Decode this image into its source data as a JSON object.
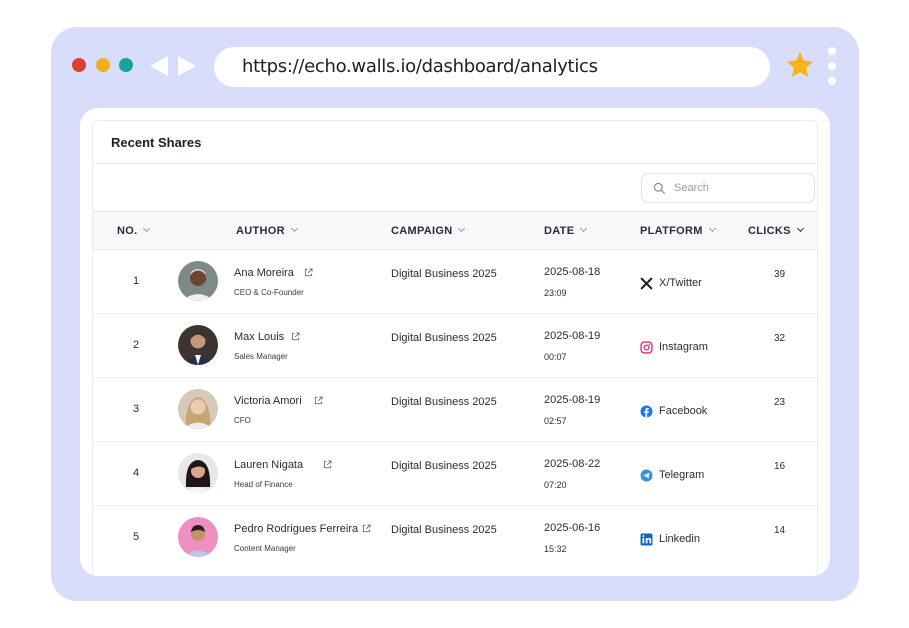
{
  "browser": {
    "url": "https://echo.walls.io/dashboard/analytics",
    "colors": {
      "frame": "#d9ddfc",
      "red": "#d9412e",
      "yellow": "#f2b01e",
      "teal": "#15a39b",
      "star": "#f7b418"
    }
  },
  "panel": {
    "title": "Recent Shares",
    "search_placeholder": "Search"
  },
  "table": {
    "columns": [
      "NO.",
      "AUTHOR",
      "CAMPAIGN",
      "DATE",
      "PLATFORM",
      "CLICKS"
    ],
    "rows": [
      {
        "no": "1",
        "name": "Ana Moreira",
        "role": "CEO & Co-Founder",
        "campaign": "Digital Business 2025",
        "date": "2025-08-18",
        "time": "23:09",
        "platform": "X/Twitter",
        "platform_icon": "x-twitter-icon",
        "clicks": "39"
      },
      {
        "no": "2",
        "name": "Max Louis",
        "role": "Sales Manager",
        "campaign": "Digital Business 2025",
        "date": "2025-08-19",
        "time": "00:07",
        "platform": "Instagram",
        "platform_icon": "instagram-icon",
        "clicks": "32"
      },
      {
        "no": "3",
        "name": "Victoria Amori",
        "role": "CFO",
        "campaign": "Digital Business 2025",
        "date": "2025-08-19",
        "time": "02:57",
        "platform": "Facebook",
        "platform_icon": "facebook-icon",
        "clicks": "23"
      },
      {
        "no": "4",
        "name": "Lauren Nigata",
        "role": "Head of Finance",
        "campaign": "Digital Business 2025",
        "date": "2025-08-22",
        "time": "07:20",
        "platform": "Telegram",
        "platform_icon": "telegram-icon",
        "clicks": "16"
      },
      {
        "no": "5",
        "name": "Pedro Rodrigues Ferreira",
        "role": "Content Manager",
        "campaign": "Digital Business 2025",
        "date": "2025-06-16",
        "time": "15:32",
        "platform": "Linkedin",
        "platform_icon": "linkedin-icon",
        "clicks": "14"
      }
    ]
  }
}
